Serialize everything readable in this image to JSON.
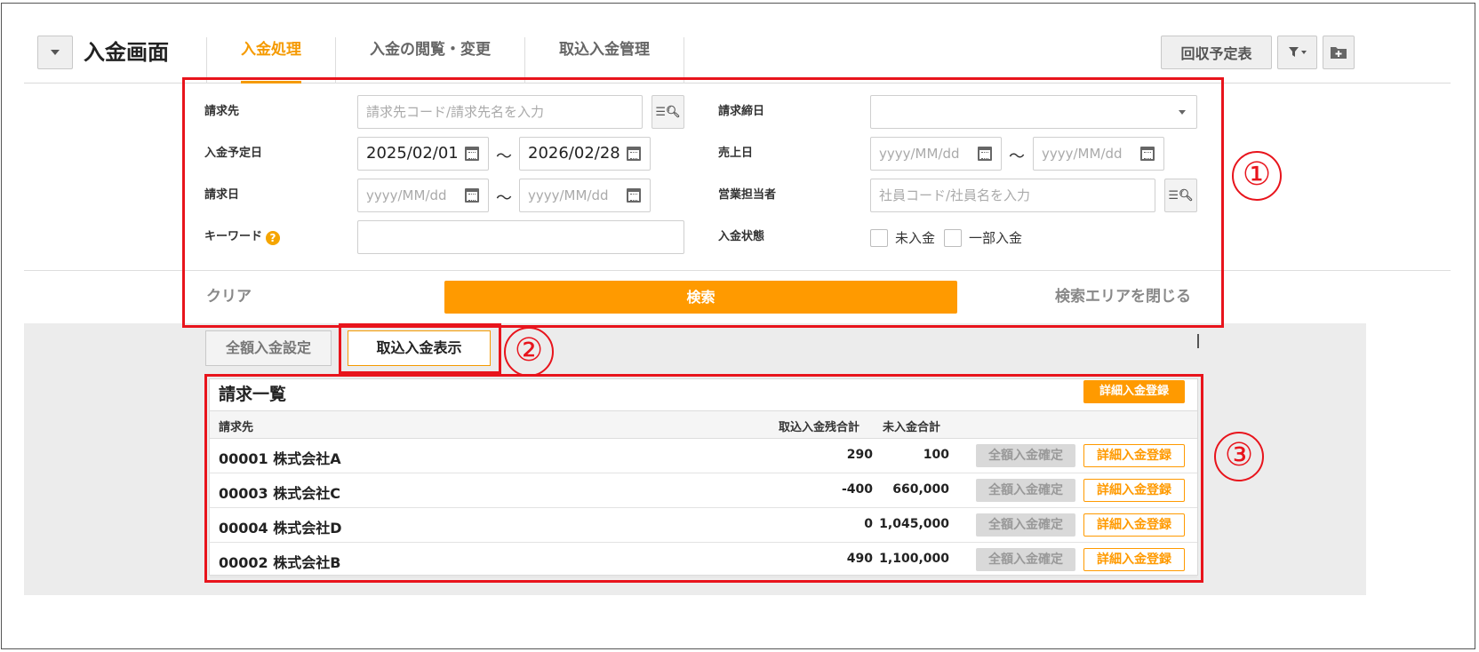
{
  "header": {
    "title": "入金画面",
    "tabs": [
      "入金処理",
      "入金の閲覧・変更",
      "取込入金管理"
    ],
    "schedule_button": "回収予定表"
  },
  "search": {
    "billing_to_label": "請求先",
    "billing_to_placeholder": "請求先コード/請求先名を入力",
    "closing_day_label": "請求締日",
    "due_date_label": "入金予定日",
    "due_date_from": "2025/02/01",
    "due_date_to": "2026/02/28",
    "tilde": "～",
    "sales_date_label": "売上日",
    "date_placeholder": "yyyy/MM/dd",
    "invoice_date_label": "請求日",
    "staff_label": "営業担当者",
    "staff_placeholder": "社員コード/社員名を入力",
    "keyword_label": "キーワード",
    "help": "?",
    "status_label": "入金状態",
    "status_options": [
      "未入金",
      "一部入金"
    ],
    "clear": "クリア",
    "search_button": "検索",
    "close_area": "検索エリアを閉じる"
  },
  "subtabs": [
    "全額入金設定",
    "取込入金表示"
  ],
  "list": {
    "title": "請求一覧",
    "register_detail": "詳細入金登録",
    "columns": [
      "請求先",
      "取込入金残合計",
      "未入金合計"
    ],
    "confirm_full": "全額入金確定",
    "rows": [
      {
        "name": "00001 株式会社A",
        "imported": "290",
        "unpaid": "100"
      },
      {
        "name": "00003 株式会社C",
        "imported": "-400",
        "unpaid": "660,000"
      },
      {
        "name": "00004 株式会社D",
        "imported": "0",
        "unpaid": "1,045,000"
      },
      {
        "name": "00002 株式会社B",
        "imported": "490",
        "unpaid": "1,100,000"
      }
    ]
  },
  "annotations": [
    "①",
    "②",
    "③"
  ],
  "colors": {
    "accent": "#ff9a00",
    "annotation": "#e8141c"
  }
}
